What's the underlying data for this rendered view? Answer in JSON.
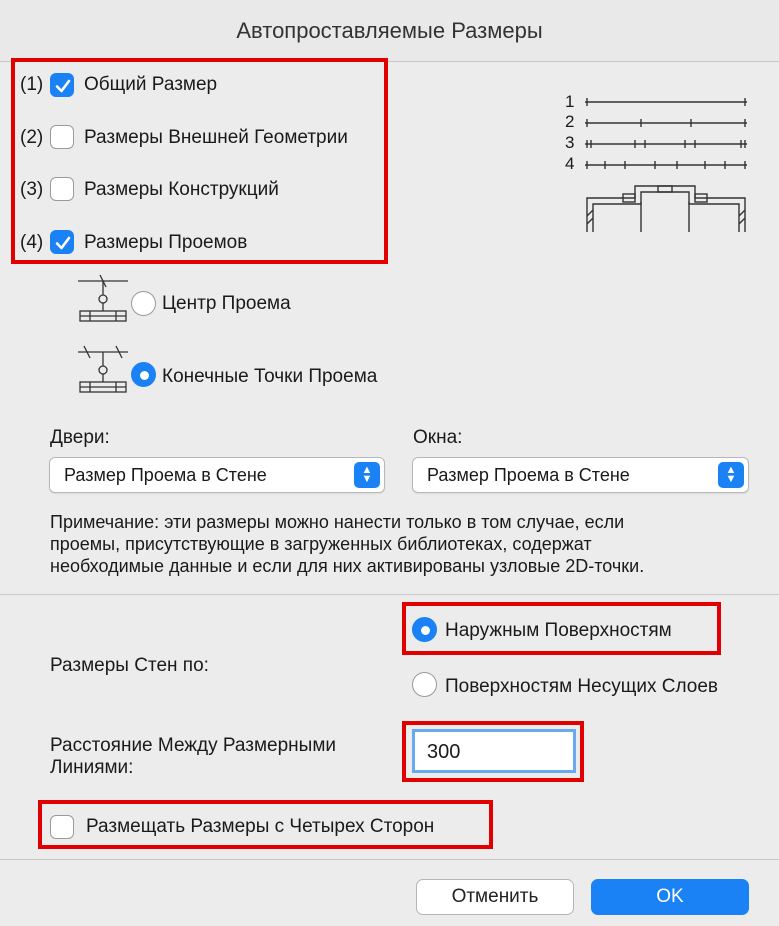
{
  "window": {
    "title": "Автопроставляемые Размеры"
  },
  "options": [
    {
      "num": "(1)",
      "label": "Общий Размер",
      "checked": true
    },
    {
      "num": "(2)",
      "label": "Размеры Внешней Геометрии",
      "checked": false
    },
    {
      "num": "(3)",
      "label": "Размеры Конструкций",
      "checked": false
    },
    {
      "num": "(4)",
      "label": "Размеры Проемов",
      "checked": true
    }
  ],
  "preview": {
    "labels": [
      "1",
      "2",
      "3",
      "4"
    ]
  },
  "opening": {
    "center_label": "Центр Проема",
    "ends_label": "Конечные Точки Проема",
    "selected": "ends"
  },
  "doors": {
    "label": "Двери:",
    "value": "Размер Проема в Стене"
  },
  "windows": {
    "label": "Окна:",
    "value": "Размер Проема в Стене"
  },
  "note": {
    "line1": "Примечание: эти размеры можно нанести только в том случае, если",
    "line2": "проемы, присутствующие в загруженных библиотеках, содержат",
    "line3": "необходимые данные и если для них активированы узловые 2D-точки."
  },
  "walls": {
    "label": "Размеры Стен по:",
    "outer_label": "Наружным Поверхностям",
    "core_label": "Поверхностям Несущих Слоев",
    "selected": "outer"
  },
  "spacing": {
    "label_line1": "Расстояние Между Размерными",
    "label_line2": "Линиями:",
    "value": "300"
  },
  "four_sides": {
    "label": "Размещать Размеры с Четырех Сторон",
    "checked": false
  },
  "buttons": {
    "cancel": "Отменить",
    "ok": "OK"
  },
  "colors": {
    "accent": "#1a82f5",
    "highlight": "#e00000"
  }
}
